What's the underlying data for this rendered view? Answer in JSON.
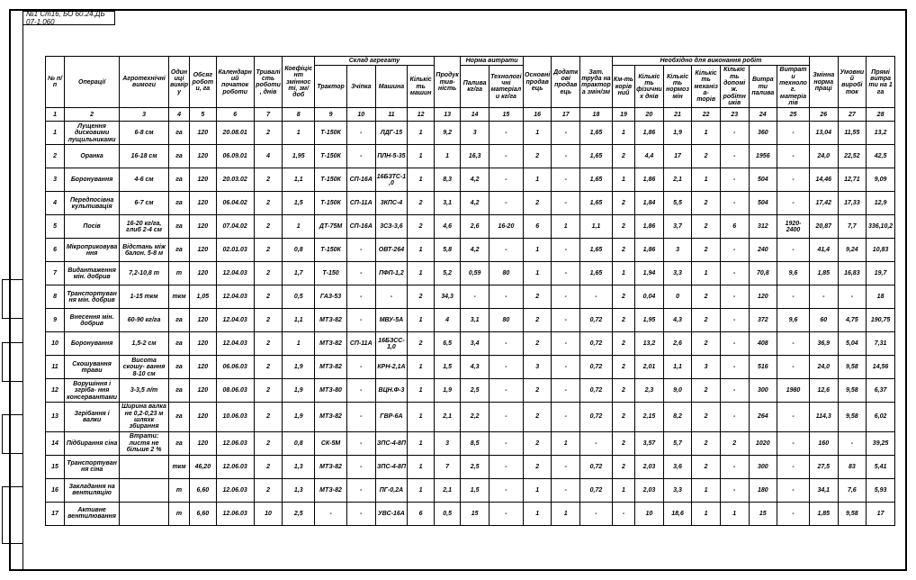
{
  "tag": "№1 Ст16, БО 60.24.ДБ 07-1.060",
  "headers": {
    "row1": {
      "c1": "№ п/п",
      "c2": "Операції",
      "c3": "Агротехнічні вимоги",
      "c4": "Одиниці виміру",
      "c5": "Обсяг роботи, га",
      "c6": "Календарний початок роботи",
      "c7": "Тривалість роботи, днів",
      "c8": "Коефіцієнт змінності, зм/доб",
      "g9": "Склад агрегату",
      "c13": "Продуктив- ність",
      "g14": "Норма витрати",
      "c16": "Основні продавець",
      "c17": "Додаткові продавець",
      "c18": "Зат. труда на трактора змін/зм",
      "g19": "Необхідно для виконання робіт",
      "c26": "Змінна норма праці",
      "c27": "Умовний виробіток",
      "c28": "Прямі витрати на 1 га"
    },
    "row2": {
      "c9": "Трактор",
      "c10": "Зчіпка",
      "c11": "Машина",
      "c12": "Кількість машин",
      "c14": "Палива кг/га",
      "c15": "Технологічні матеріали кг/га",
      "c19": "Км-ть корівний",
      "c20": "Кількість фізичних днів",
      "c21": "Кількість нормозмін",
      "c22": "Кількість механіза- торів",
      "c23": "Кількість допоміж. робітників",
      "c24": "Витрати палива",
      "c25": "Витрати технолог. матеріалів"
    },
    "numrow": [
      "1",
      "2",
      "3",
      "4",
      "5",
      "6",
      "7",
      "8",
      "9",
      "10",
      "11",
      "12",
      "13",
      "14",
      "15",
      "16",
      "17",
      "18",
      "19",
      "20",
      "21",
      "22",
      "23",
      "24",
      "25",
      "26",
      "27",
      "28"
    ]
  },
  "rows": [
    [
      "1",
      "Лущення дисковими лущильниками",
      "6-8 см",
      "га",
      "120",
      "20.08.01",
      "2",
      "1",
      "Т-150К",
      "-",
      "ЛДГ-15",
      "1",
      "9,2",
      "3",
      "-",
      "1",
      "-",
      "1,65",
      "1",
      "1,86",
      "1,9",
      "1",
      "-",
      "360",
      "-",
      "13,04",
      "11,55",
      "13,2"
    ],
    [
      "2",
      "Оранка",
      "16-18 см",
      "га",
      "120",
      "06.09.01",
      "4",
      "1,95",
      "Т-150К",
      "-",
      "ПЛН-5-35",
      "1",
      "1",
      "16,3",
      "-",
      "2",
      "-",
      "1,65",
      "2",
      "4,4",
      "17",
      "2",
      "-",
      "1956",
      "-",
      "24,0",
      "22,52",
      "42,5"
    ],
    [
      "3",
      "Боронування",
      "4-6 см",
      "га",
      "120",
      "20.03.02",
      "2",
      "1,1",
      "Т-150К",
      "СП-16А",
      "16БЗТС-1,0",
      "1",
      "8,3",
      "4,2",
      "-",
      "1",
      "-",
      "1,65",
      "1",
      "1,86",
      "2,1",
      "1",
      "-",
      "504",
      "-",
      "14,46",
      "12,71",
      "9,09"
    ],
    [
      "4",
      "Передпосівна культивація",
      "6-7 см",
      "га",
      "120",
      "06.04.02",
      "2",
      "1,5",
      "Т-150К",
      "СП-11А",
      "3КПС-4",
      "2",
      "3,1",
      "4,2",
      "-",
      "2",
      "-",
      "1,65",
      "2",
      "1,84",
      "5,5",
      "2",
      "-",
      "504",
      "-",
      "17,42",
      "17,33",
      "12,9"
    ],
    [
      "5",
      "Посів",
      "16-20 кг/га, глиб 2-4 см",
      "га",
      "120",
      "07.04.02",
      "2",
      "1",
      "ДТ-75М",
      "СП-16А",
      "3СЗ-3,6",
      "2",
      "4,6",
      "2,6",
      "16-20",
      "6",
      "1",
      "1,1",
      "2",
      "1,86",
      "3,7",
      "2",
      "6",
      "312",
      "1920-2400",
      "20,87",
      "7,7",
      "336,10,2"
    ],
    [
      "6",
      "Мікроприковування",
      "Відстань між балон. 5-8 м",
      "га",
      "120",
      "02.01.03",
      "2",
      "0,8",
      "Т-150К",
      "-",
      "ОВТ-264",
      "1",
      "5,8",
      "4,2",
      "-",
      "1",
      "-",
      "1,65",
      "2",
      "1,86",
      "3",
      "2",
      "-",
      "240",
      "-",
      "41,4",
      "9,24",
      "10,83"
    ],
    [
      "7",
      "Видантаження мін. добрив",
      "7,2-10,8 т",
      "т",
      "120",
      "12.04.03",
      "2",
      "1,7",
      "Т-150",
      "-",
      "ПФП-1,2",
      "1",
      "5,2",
      "0,59",
      "80",
      "1",
      "-",
      "1,65",
      "1",
      "1,94",
      "3,3",
      "1",
      "-",
      "70,8",
      "9,6",
      "1,85",
      "16,83",
      "19,7"
    ],
    [
      "8",
      "Транспортування мін. добрив",
      "1-15 ткм",
      "ткм",
      "1,05",
      "12.04.03",
      "2",
      "0,5",
      "ГАЗ-53",
      "-",
      "-",
      "2",
      "34,3",
      "-",
      "-",
      "2",
      "-",
      "-",
      "2",
      "0,04",
      "0",
      "2",
      "-",
      "120",
      "-",
      "-",
      "-",
      "18"
    ],
    [
      "9",
      "Внесення мін. добрив",
      "60-90 кг/га",
      "га",
      "120",
      "12.04.03",
      "2",
      "1,1",
      "МТЗ-82",
      "-",
      "МВУ-5А",
      "1",
      "4",
      "3,1",
      "80",
      "2",
      "-",
      "0,72",
      "2",
      "1,95",
      "4,3",
      "2",
      "-",
      "372",
      "9,6",
      "60",
      "4,75",
      "190,75"
    ],
    [
      "10",
      "Боронування",
      "1,5-2 см",
      "га",
      "120",
      "12.04.03",
      "2",
      "1",
      "МТЗ-82",
      "СП-11А",
      "16БЗСС-1,0",
      "2",
      "6,5",
      "3,4",
      "-",
      "2",
      "-",
      "0,72",
      "2",
      "13,2",
      "2,6",
      "2",
      "-",
      "408",
      "-",
      "36,9",
      "5,04",
      "7,31"
    ],
    [
      "11",
      "Скошування трави",
      "Висота скошу- вання 8-10 см",
      "га",
      "120",
      "06.06.03",
      "2",
      "1,9",
      "МТЗ-82",
      "-",
      "КРН-2,1А",
      "1",
      "1,5",
      "4,3",
      "-",
      "3",
      "-",
      "0,72",
      "2",
      "2,01",
      "1,1",
      "3",
      "-",
      "516",
      "-",
      "24,0",
      "9,58",
      "14,56"
    ],
    [
      "12",
      "Ворушіння і згріба- ння консервантами",
      "3-3,5 л/т",
      "га",
      "120",
      "08.06.03",
      "2",
      "1,9",
      "МТЗ-80",
      "-",
      "ВЦН.Ф-3",
      "1",
      "1,9",
      "2,5",
      "-",
      "2",
      "-",
      "0,72",
      "2",
      "2,3",
      "9,0",
      "2",
      "-",
      "300",
      "1980",
      "12,6",
      "9,58",
      "6,37"
    ],
    [
      "13",
      "Згрібання і валки",
      "Ширина валка не 0,2-0,23 м шляхк збирання",
      "га",
      "120",
      "10.06.03",
      "2",
      "1,9",
      "МТЗ-82",
      "-",
      "ГВР-6А",
      "1",
      "2,1",
      "2,2",
      "-",
      "2",
      "-",
      "0,72",
      "2",
      "2,15",
      "8,2",
      "2",
      "-",
      "264",
      "-",
      "114,3",
      "9,58",
      "6,02"
    ],
    [
      "14",
      "Підбирання сіна",
      "Втрати: листя не більше 2 %",
      "га",
      "120",
      "12.06.03",
      "2",
      "0,8",
      "СК-5М",
      "-",
      "ЗПС-4-8П",
      "1",
      "3",
      "8,5",
      "-",
      "2",
      "1",
      "-",
      "2",
      "3,57",
      "5,7",
      "2",
      "2",
      "1020",
      "-",
      "160",
      "-",
      "39,25"
    ],
    [
      "15",
      "Транспортування сіна",
      "",
      "ткм",
      "46,20",
      "12.06.03",
      "2",
      "1,3",
      "МТЗ-82",
      "-",
      "ЗПС-4-8П",
      "1",
      "7",
      "2,5",
      "-",
      "2",
      "-",
      "0,72",
      "2",
      "2,03",
      "3,6",
      "2",
      "-",
      "300",
      "-",
      "27,5",
      "83",
      "5,41"
    ],
    [
      "16",
      "Закладання на вентиляцію",
      "",
      "т",
      "6,60",
      "12.06.03",
      "2",
      "1,3",
      "МТЗ-82",
      "-",
      "ПГ-0,2А",
      "1",
      "2,1",
      "1,5",
      "-",
      "1",
      "-",
      "0,72",
      "1",
      "2,03",
      "3,3",
      "1",
      "-",
      "180",
      "-",
      "34,1",
      "7,6",
      "5,93"
    ],
    [
      "17",
      "Активне вентилювання",
      "",
      "т",
      "6,60",
      "12.06.03",
      "10",
      "2,5",
      "-",
      "-",
      "УВС-16А",
      "6",
      "0,5",
      "15",
      "-",
      "1",
      "1",
      "-",
      "-",
      "10",
      "18,6",
      "1",
      "1",
      "15",
      "-",
      "1,85",
      "9,58",
      "17"
    ]
  ]
}
